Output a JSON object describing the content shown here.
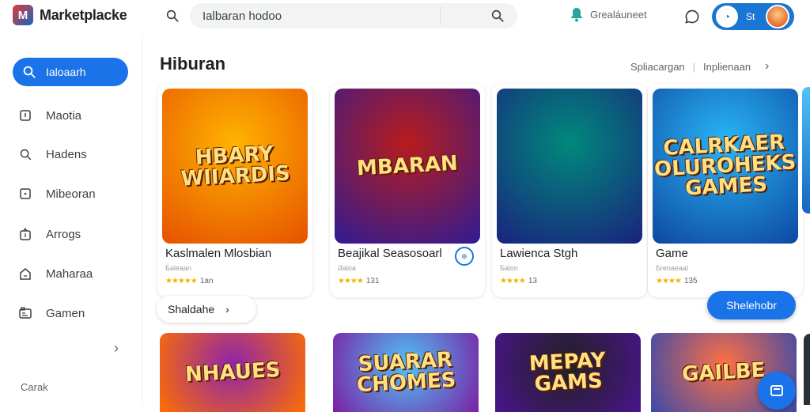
{
  "brand": {
    "name": "Marketplacke",
    "logo_letter": "M"
  },
  "search": {
    "value": "Ialbaran hodoo",
    "placeholder": "Ialbaran hodoo"
  },
  "status": {
    "text": "Grealáuneet"
  },
  "account": {
    "label": "St"
  },
  "sidebar": {
    "active": {
      "label": "Ialoaarh"
    },
    "items": [
      {
        "label": "Maotia",
        "icon": "doc-icon"
      },
      {
        "label": "Hadens",
        "icon": "search-icon"
      },
      {
        "label": "Mibeoran",
        "icon": "box-icon"
      },
      {
        "label": "Arrogs",
        "icon": "gift-icon"
      },
      {
        "label": "Maharaa",
        "icon": "home-icon"
      },
      {
        "label": "Gamen",
        "icon": "gamepad-icon"
      }
    ],
    "footer": "Carak"
  },
  "section": {
    "title": "Hiburan",
    "link1": "Spliacargan",
    "link2": "Inplienaan"
  },
  "cards": [
    {
      "art_text": "HBARY WIIARDIS",
      "title": "Kaslmalen Mlosbian",
      "sub": "Ƃaleaan",
      "rating": "1an",
      "colors": [
        "#ffb300",
        "#e65100"
      ]
    },
    {
      "art_text": "MBARAN",
      "title": "Beajikal Seasosoarl",
      "sub": "Ƌaloa",
      "rating": "131",
      "colors": [
        "#b71c1c",
        "#311b92"
      ],
      "badge": "⊕"
    },
    {
      "art_text": "",
      "title": "Lawienca Stgh",
      "sub": "Ƃalon",
      "rating": "13",
      "colors": [
        "#00897b",
        "#1a237e"
      ]
    },
    {
      "art_text": "CALRKAER OLUROHEKS GAMES",
      "title": "Game",
      "sub": "Ƃreoaeaal",
      "rating": "135",
      "colors": [
        "#29b6f6",
        "#0d47a1"
      ]
    }
  ],
  "row2": [
    {
      "art_text": "NHAUES",
      "colors": [
        "#8e24aa",
        "#ff6f00"
      ]
    },
    {
      "art_text": "SUARAR CHOMES",
      "colors": [
        "#4fc3f7",
        "#7b1fa2"
      ]
    },
    {
      "art_text": "MEPAY GAMS",
      "colors": [
        "#212121",
        "#4a148c"
      ]
    },
    {
      "art_text": "GAILBE",
      "colors": [
        "#ff7043",
        "#3949ab"
      ]
    }
  ],
  "chip": {
    "label": "Shaldahe"
  },
  "fab": {
    "label": "Shelehobr"
  }
}
